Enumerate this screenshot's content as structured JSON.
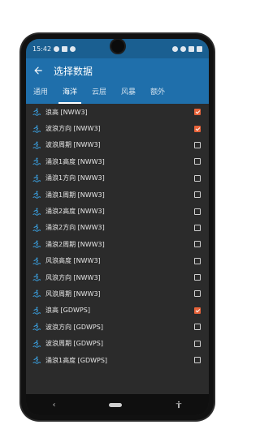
{
  "status": {
    "time": "15:42"
  },
  "header": {
    "title": "选择数据"
  },
  "tabs": [
    {
      "label": "通用",
      "active": false
    },
    {
      "label": "海洋",
      "active": true
    },
    {
      "label": "云层",
      "active": false
    },
    {
      "label": "风暴",
      "active": false
    },
    {
      "label": "额外",
      "active": false
    }
  ],
  "items": [
    {
      "label": "浪高 [NWW3]",
      "checked": true
    },
    {
      "label": "波浪方向 [NWW3]",
      "checked": true
    },
    {
      "label": "波浪周期 [NWW3]",
      "checked": false
    },
    {
      "label": "涌浪1高度 [NWW3]",
      "checked": false
    },
    {
      "label": "涌浪1方向 [NWW3]",
      "checked": false
    },
    {
      "label": "涌浪1周期 [NWW3]",
      "checked": false
    },
    {
      "label": "涌浪2高度 [NWW3]",
      "checked": false
    },
    {
      "label": "涌浪2方向 [NWW3]",
      "checked": false
    },
    {
      "label": "涌浪2周期 [NWW3]",
      "checked": false
    },
    {
      "label": "风浪高度 [NWW3]",
      "checked": false
    },
    {
      "label": "风浪方向 [NWW3]",
      "checked": false
    },
    {
      "label": "风浪周期 [NWW3]",
      "checked": false
    },
    {
      "label": "浪高 [GDWPS]",
      "checked": true
    },
    {
      "label": "波浪方向 [GDWPS]",
      "checked": false
    },
    {
      "label": "波浪周期 [GDWPS]",
      "checked": false
    },
    {
      "label": "涌浪1高度 [GDWPS]",
      "checked": false
    }
  ],
  "colors": {
    "accent": "#e7633a",
    "appbar": "#1f6fab",
    "icon": "#3aa0e0"
  },
  "icons": {
    "row": "wave-surfer-icon",
    "back": "arrow-back-icon"
  },
  "navbar": {
    "back": "‹"
  }
}
